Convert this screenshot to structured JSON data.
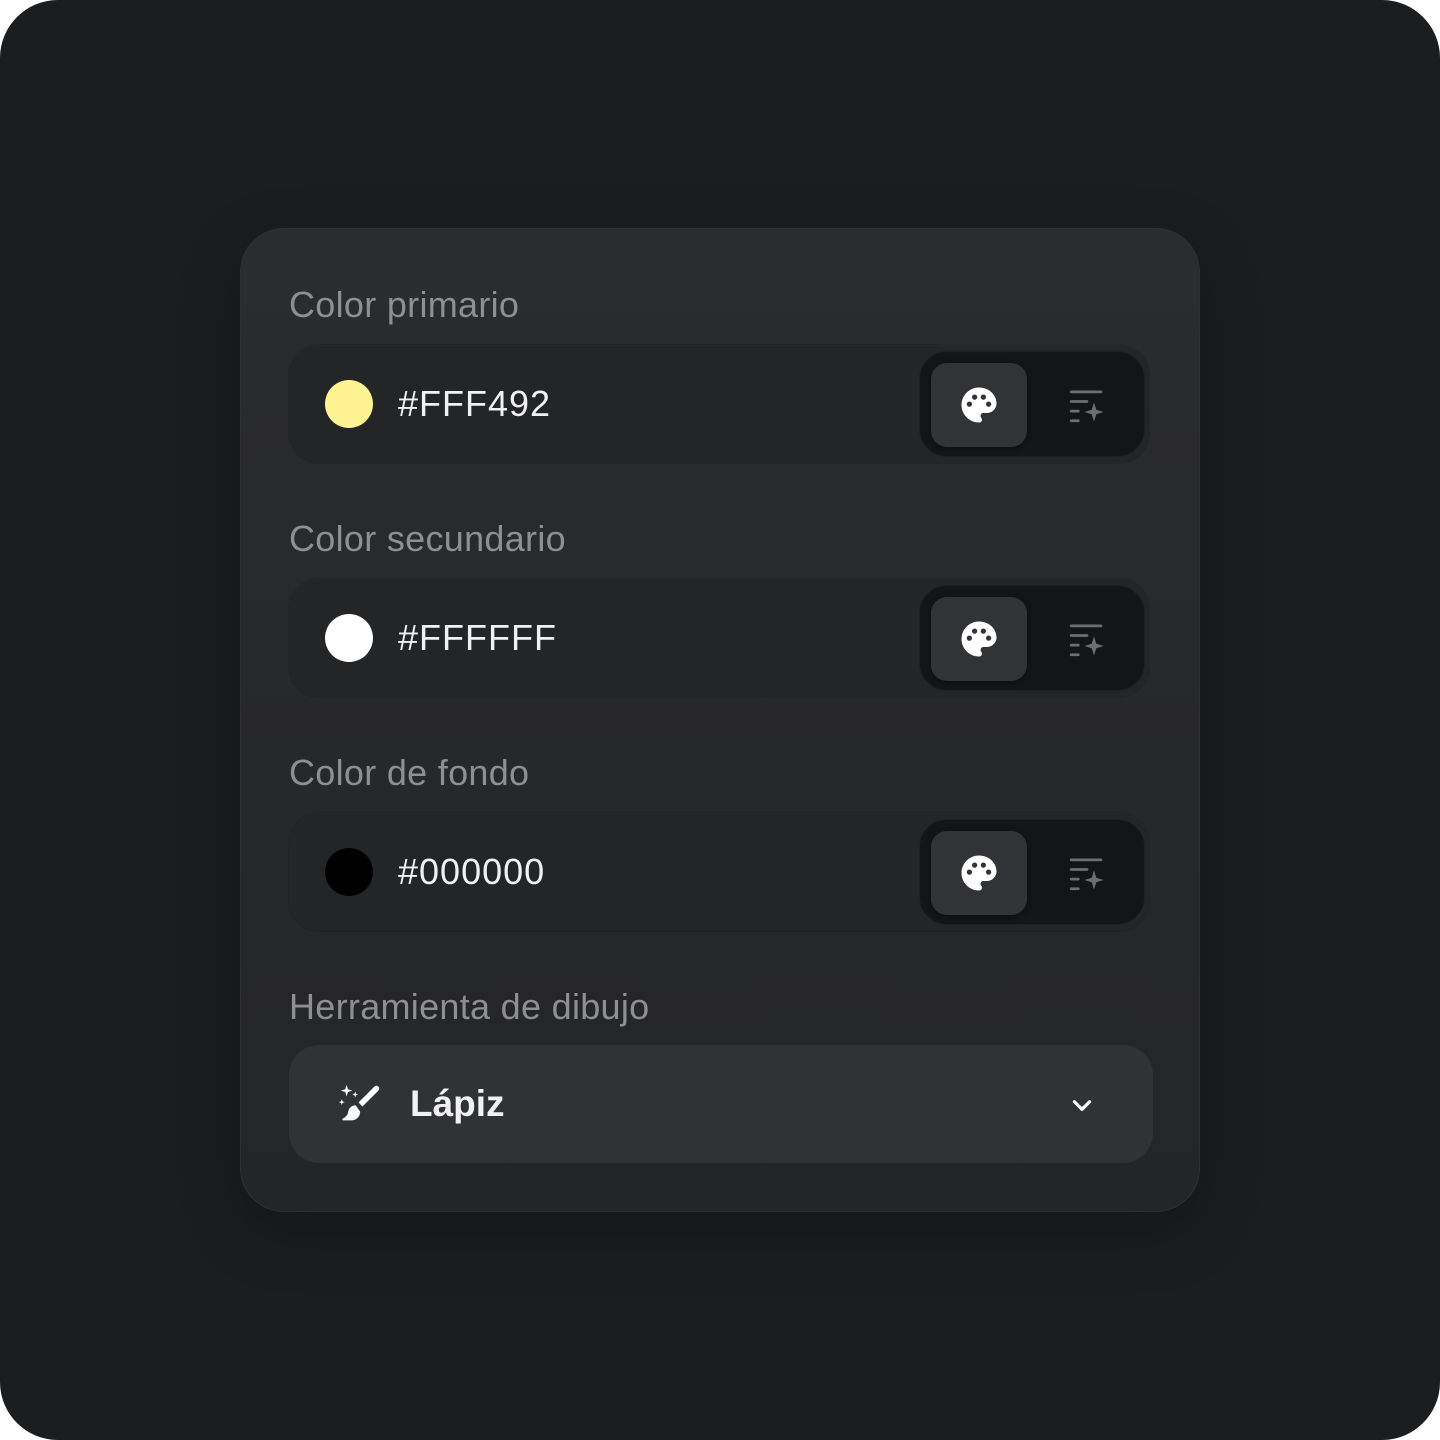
{
  "primary": {
    "label": "Color primario",
    "value": "#FFF492",
    "swatch_color": "#FFF492",
    "active_mode": "palette"
  },
  "secondary": {
    "label": "Color secundario",
    "value": "#FFFFFF",
    "swatch_color": "#FFFFFF",
    "active_mode": "palette"
  },
  "background": {
    "label": "Color de fondo",
    "value": "#000000",
    "swatch_color": "#000000",
    "active_mode": "palette"
  },
  "mode_icons": {
    "palette": "palette-icon",
    "generate": "list-sparkle-icon"
  },
  "tool": {
    "label": "Herramienta de dibujo",
    "value": "Lápiz",
    "icon": "magic-brush-icon",
    "dropdown_icon": "chevron-down-icon"
  },
  "colors": {
    "page_background": "#1C1D1F",
    "card_background": "#2B2C2E",
    "label_text": "#8E8F93",
    "value_text": "#F1F1F2"
  }
}
